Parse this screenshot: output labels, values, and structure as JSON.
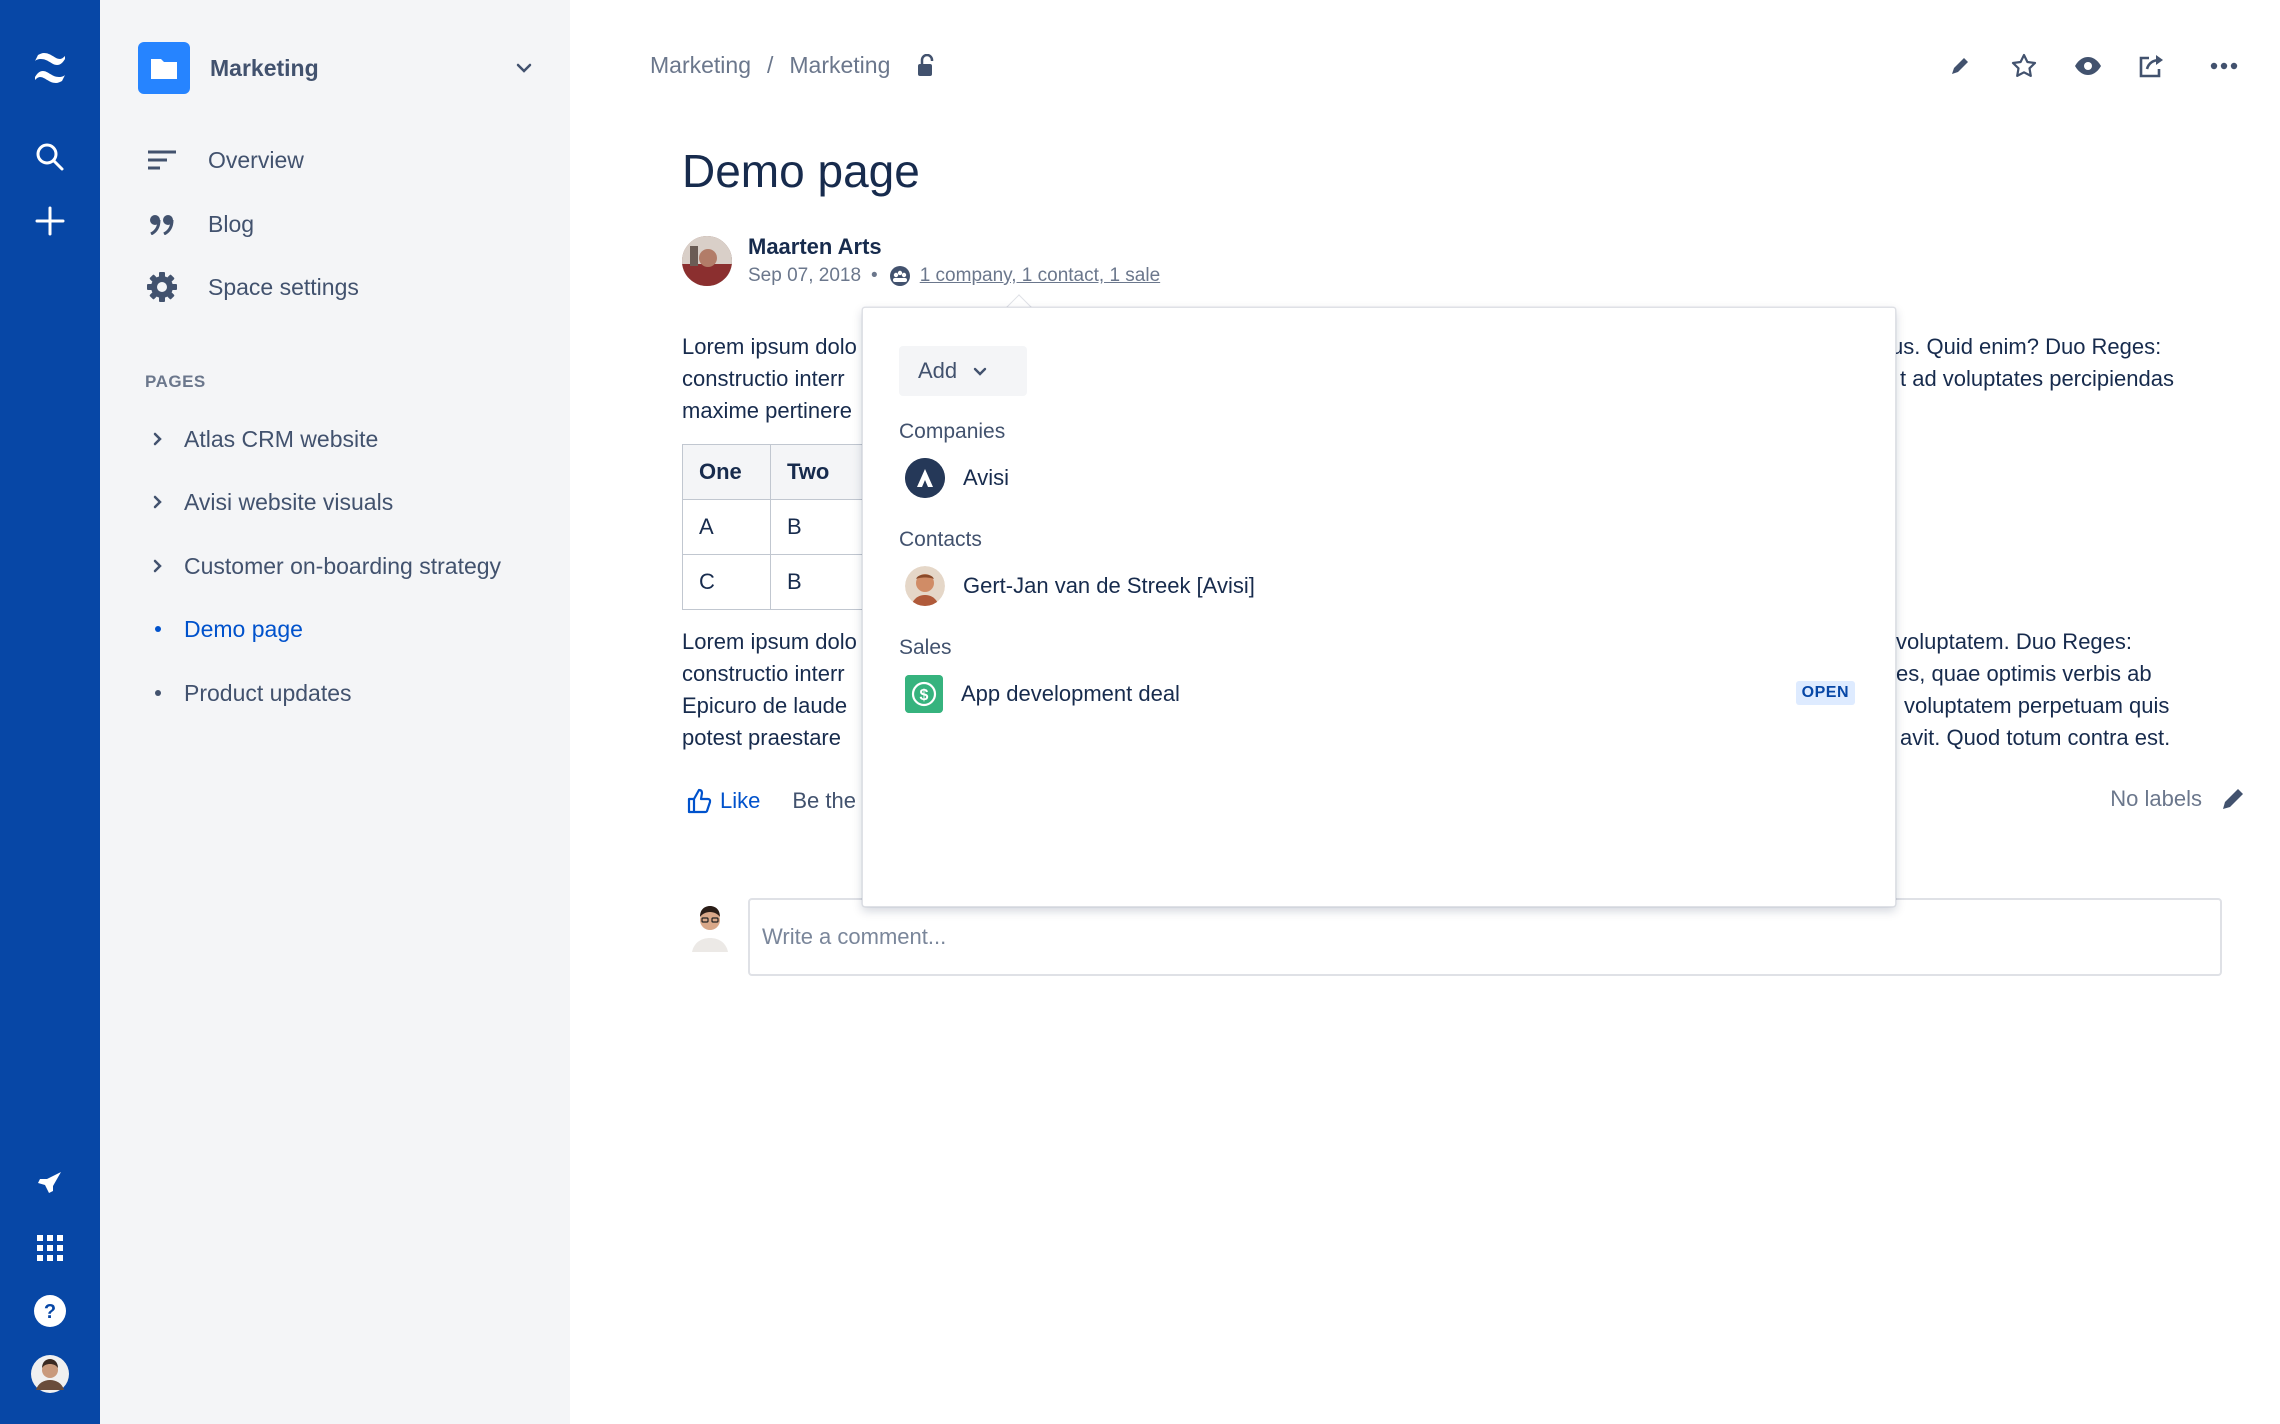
{
  "global_nav": {
    "icons": [
      "confluence-logo-icon",
      "search-icon",
      "create-icon",
      "feedback-icon",
      "app-switcher-icon",
      "help-icon",
      "profile-avatar"
    ]
  },
  "sidebar": {
    "space_name": "Marketing",
    "nav_items": [
      {
        "label": "Overview",
        "icon": "overview-icon"
      },
      {
        "label": "Blog",
        "icon": "quote-icon"
      },
      {
        "label": "Space settings",
        "icon": "gear-icon"
      }
    ],
    "pages_heading": "PAGES",
    "pages": [
      {
        "label": "Atlas CRM website",
        "marker": "chevron"
      },
      {
        "label": "Avisi website visuals",
        "marker": "chevron"
      },
      {
        "label": "Customer on-boarding strategy",
        "marker": "chevron"
      },
      {
        "label": "Demo page",
        "marker": "bullet",
        "active": true
      },
      {
        "label": "Product updates",
        "marker": "bullet"
      }
    ]
  },
  "breadcrumb": {
    "items": [
      "Marketing",
      "Marketing"
    ],
    "separator": "/"
  },
  "page": {
    "title": "Demo page",
    "author": "Maarten Arts",
    "date": "Sep 07, 2018",
    "crm_summary": "1 company, 1 contact, 1 sale",
    "para1": {
      "lines_left": [
        "Lorem ipsum dolo",
        "constructio interr",
        "maxime pertinere"
      ],
      "lines_right": [
        "us. Quid enim? Duo Reges:",
        "t ad voluptates percipiendas",
        ""
      ]
    },
    "table": {
      "headers": [
        "One",
        "Two"
      ],
      "rows": [
        [
          "A",
          "B"
        ],
        [
          "C",
          "B"
        ]
      ]
    },
    "para2": {
      "lines_left": [
        "Lorem ipsum dolo",
        "constructio interr",
        "Epicuro de laude",
        "potest praestare"
      ],
      "lines_right": [
        "voluptatem. Duo Reges:",
        "es, quae optimis verbis ab",
        "voluptatem perpetuam quis",
        "avit. Quod totum contra est."
      ]
    },
    "like_label": "Like",
    "like_message": "Be the",
    "no_labels": "No labels",
    "comment_placeholder": "Write a comment..."
  },
  "popup": {
    "add_label": "Add",
    "companies_title": "Companies",
    "company": "Avisi",
    "contacts_title": "Contacts",
    "contact": "Gert-Jan van de Streek [Avisi]",
    "sales_title": "Sales",
    "sale": "App development deal",
    "sale_status": "OPEN"
  },
  "colors": {
    "global_nav_bg": "#0747A6",
    "sidebar_bg": "#F4F5F7",
    "link": "#0052CC",
    "sale_icon_bg": "#36B37E",
    "badge_bg": "#DEEBFF"
  }
}
